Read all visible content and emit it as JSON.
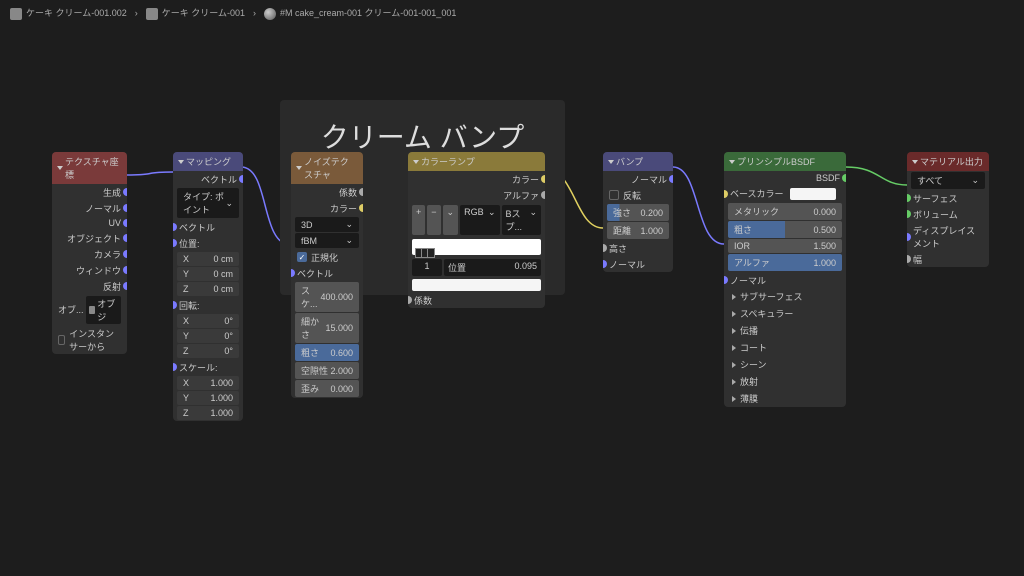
{
  "breadcrumb": {
    "item1": "ケーキ クリーム-001.002",
    "item2": "ケーキ クリーム-001",
    "item3": "#M cake_cream-001 クリーム-001-001_001"
  },
  "frame": {
    "title": "クリーム バンプ"
  },
  "texcoord": {
    "title": "テクスチャ座標",
    "outputs": {
      "generated": "生成",
      "normal": "ノーマル",
      "uv": "UV",
      "object": "オブジェクト",
      "camera": "カメラ",
      "window": "ウィンドウ",
      "reflection": "反射"
    },
    "obj_label": "オブ...",
    "obj_field": "オブジ",
    "instancer": "インスタンサーから"
  },
  "mapping": {
    "title": "マッピング",
    "out_vector": "ベクトル",
    "type_label": "タイプ:",
    "type_value": "ポイント",
    "in_vector": "ベクトル",
    "loc": "位置:",
    "rot": "回転:",
    "scale": "スケール:",
    "x": "X",
    "y": "Y",
    "z": "Z",
    "loc_val": "0 cm",
    "rot_val": "0°",
    "scale_val": "1.000"
  },
  "noise": {
    "title": "ノイズテクスチャ",
    "out_fac": "係数",
    "out_color": "カラー",
    "dim": "3D",
    "type": "fBM",
    "normalize": "正規化",
    "in_vector": "ベクトル",
    "scale_l": "スケ...",
    "scale_v": "400.000",
    "detail_l": "細かさ",
    "detail_v": "15.000",
    "rough_l": "粗さ",
    "rough_v": "0.600",
    "lac_l": "空隙性",
    "lac_v": "2.000",
    "dist_l": "歪み",
    "dist_v": "0.000"
  },
  "ramp": {
    "title": "カラーランプ",
    "out_color": "カラー",
    "out_alpha": "アルファ",
    "add": "+",
    "remove": "−",
    "mode": "RGB",
    "interp": "Bスプ...",
    "idx": "1",
    "pos_l": "位置",
    "pos_v": "0.095",
    "in_fac": "係数"
  },
  "bump": {
    "title": "バンプ",
    "out_normal": "ノーマル",
    "invert": "反転",
    "strength_l": "強さ",
    "strength_v": "0.200",
    "dist_l": "距離",
    "dist_v": "1.000",
    "height": "高さ",
    "normal": "ノーマル"
  },
  "bsdf": {
    "title": "プリンシプルBSDF",
    "out": "BSDF",
    "basecolor": "ベースカラー",
    "metallic_l": "メタリック",
    "metallic_v": "0.000",
    "rough_l": "粗さ",
    "rough_v": "0.500",
    "ior_l": "IOR",
    "ior_v": "1.500",
    "alpha_l": "アルファ",
    "alpha_v": "1.000",
    "normal": "ノーマル",
    "subsurface": "サブサーフェス",
    "specular": "スペキュラー",
    "transmission": "伝播",
    "coat": "コート",
    "sheen": "シーン",
    "emission": "放射",
    "thin": "薄膜"
  },
  "output": {
    "title": "マテリアル出力",
    "target": "すべて",
    "surface": "サーフェス",
    "volume": "ボリューム",
    "displacement": "ディスプレイスメント",
    "thickness": "幅"
  }
}
